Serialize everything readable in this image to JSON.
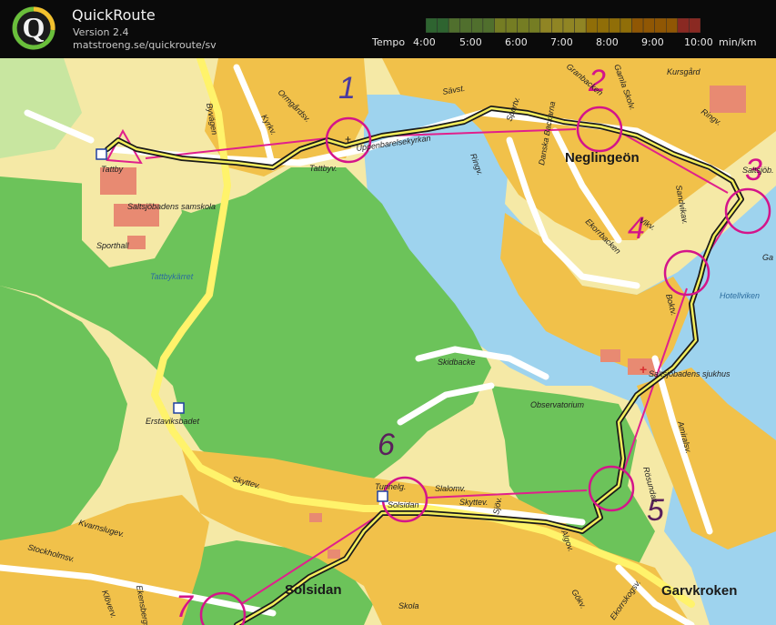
{
  "app": {
    "title": "QuickRoute",
    "version": "Version 2.4",
    "url": "matstroeng.se/quickroute/sv"
  },
  "pace_legend": {
    "label": "Tempo",
    "ticks": [
      "4:00",
      "5:00",
      "6:00",
      "7:00",
      "8:00",
      "9:00",
      "10:00"
    ],
    "unit": "min/km",
    "colors": [
      "#4caf50",
      "#8bc34a",
      "#cddc39",
      "#ffeb3b",
      "#ffc107",
      "#ff9800",
      "#f44336"
    ]
  },
  "map": {
    "colors": {
      "forest": "#6cc35a",
      "open_land": "#f5e9a6",
      "urban": "#f1c14a",
      "water": "#9ed3ee",
      "road": "#ffffff",
      "main_road": "#fff36b",
      "course_line": "#e0208c",
      "control_circle": "#d4148a",
      "route_outline": "#1a1a1a"
    },
    "controls": [
      {
        "number": "1",
        "color": "#4a3aa0"
      },
      {
        "number": "2",
        "color": "#d4148a"
      },
      {
        "number": "3",
        "color": "#d4148a"
      },
      {
        "number": "4",
        "color": "#d4148a"
      },
      {
        "number": "5",
        "color": "#5a1f5c"
      },
      {
        "number": "6",
        "color": "#5a1f5c"
      },
      {
        "number": "7",
        "color": "#d4148a"
      }
    ],
    "place_labels": [
      {
        "text": "Neglingeön"
      },
      {
        "text": "Solsidan"
      },
      {
        "text": "Garvkroken"
      }
    ],
    "small_labels": [
      {
        "text": "Byvägen"
      },
      {
        "text": "Ormgårdsv."
      },
      {
        "text": "Kyrkv."
      },
      {
        "text": "Sävst."
      },
      {
        "text": "Uppenbarelsekyrkan"
      },
      {
        "text": "Tattbyv."
      },
      {
        "text": "Tattby"
      },
      {
        "text": "Ringv."
      },
      {
        "text": "Sportv."
      },
      {
        "text": "Danska Backarna"
      },
      {
        "text": "Granbacken"
      },
      {
        "text": "Gamla Skolv."
      },
      {
        "text": "Kursgård"
      },
      {
        "text": "Ringv."
      },
      {
        "text": "Saltsjöb."
      },
      {
        "text": "Sandvikav."
      },
      {
        "text": "Vikv."
      },
      {
        "text": "Ekorrbacken"
      },
      {
        "text": "Saltsjöbadens samskola"
      },
      {
        "text": "Sporthall"
      },
      {
        "text": "Tattbykärret"
      },
      {
        "text": "Hotellviken"
      },
      {
        "text": "Boktv."
      },
      {
        "text": "Saltsjöbadens sjukhus"
      },
      {
        "text": "Skidbacke"
      },
      {
        "text": "Observatorium"
      },
      {
        "text": "Erstaviksbadet"
      },
      {
        "text": "Amiralsv."
      },
      {
        "text": "Rösundav."
      },
      {
        "text": "Tunnelg."
      },
      {
        "text": "Solsidan"
      },
      {
        "text": "Slalomv."
      },
      {
        "text": "Skyttev."
      },
      {
        "text": "Skyttev."
      },
      {
        "text": "Sjöv."
      },
      {
        "text": "Algov."
      },
      {
        "text": "Kvarnslugev."
      },
      {
        "text": "Stockholmsv."
      },
      {
        "text": "Klöverv."
      },
      {
        "text": "Skola"
      },
      {
        "text": "Gökv."
      },
      {
        "text": "Ekorrskogsv."
      },
      {
        "text": "Ga"
      },
      {
        "text": "Ekensbergsv."
      }
    ]
  }
}
